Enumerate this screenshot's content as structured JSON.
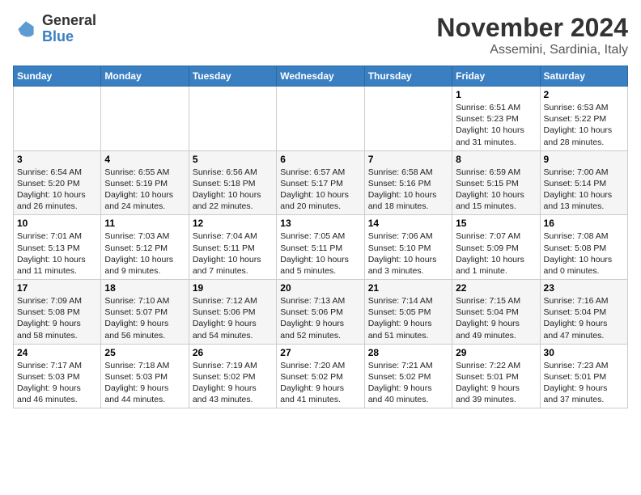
{
  "logo": {
    "general": "General",
    "blue": "Blue"
  },
  "title": "November 2024",
  "location": "Assemini, Sardinia, Italy",
  "weekdays": [
    "Sunday",
    "Monday",
    "Tuesday",
    "Wednesday",
    "Thursday",
    "Friday",
    "Saturday"
  ],
  "weeks": [
    [
      {
        "day": "",
        "info": ""
      },
      {
        "day": "",
        "info": ""
      },
      {
        "day": "",
        "info": ""
      },
      {
        "day": "",
        "info": ""
      },
      {
        "day": "",
        "info": ""
      },
      {
        "day": "1",
        "info": "Sunrise: 6:51 AM\nSunset: 5:23 PM\nDaylight: 10 hours\nand 31 minutes."
      },
      {
        "day": "2",
        "info": "Sunrise: 6:53 AM\nSunset: 5:22 PM\nDaylight: 10 hours\nand 28 minutes."
      }
    ],
    [
      {
        "day": "3",
        "info": "Sunrise: 6:54 AM\nSunset: 5:20 PM\nDaylight: 10 hours\nand 26 minutes."
      },
      {
        "day": "4",
        "info": "Sunrise: 6:55 AM\nSunset: 5:19 PM\nDaylight: 10 hours\nand 24 minutes."
      },
      {
        "day": "5",
        "info": "Sunrise: 6:56 AM\nSunset: 5:18 PM\nDaylight: 10 hours\nand 22 minutes."
      },
      {
        "day": "6",
        "info": "Sunrise: 6:57 AM\nSunset: 5:17 PM\nDaylight: 10 hours\nand 20 minutes."
      },
      {
        "day": "7",
        "info": "Sunrise: 6:58 AM\nSunset: 5:16 PM\nDaylight: 10 hours\nand 18 minutes."
      },
      {
        "day": "8",
        "info": "Sunrise: 6:59 AM\nSunset: 5:15 PM\nDaylight: 10 hours\nand 15 minutes."
      },
      {
        "day": "9",
        "info": "Sunrise: 7:00 AM\nSunset: 5:14 PM\nDaylight: 10 hours\nand 13 minutes."
      }
    ],
    [
      {
        "day": "10",
        "info": "Sunrise: 7:01 AM\nSunset: 5:13 PM\nDaylight: 10 hours\nand 11 minutes."
      },
      {
        "day": "11",
        "info": "Sunrise: 7:03 AM\nSunset: 5:12 PM\nDaylight: 10 hours\nand 9 minutes."
      },
      {
        "day": "12",
        "info": "Sunrise: 7:04 AM\nSunset: 5:11 PM\nDaylight: 10 hours\nand 7 minutes."
      },
      {
        "day": "13",
        "info": "Sunrise: 7:05 AM\nSunset: 5:11 PM\nDaylight: 10 hours\nand 5 minutes."
      },
      {
        "day": "14",
        "info": "Sunrise: 7:06 AM\nSunset: 5:10 PM\nDaylight: 10 hours\nand 3 minutes."
      },
      {
        "day": "15",
        "info": "Sunrise: 7:07 AM\nSunset: 5:09 PM\nDaylight: 10 hours\nand 1 minute."
      },
      {
        "day": "16",
        "info": "Sunrise: 7:08 AM\nSunset: 5:08 PM\nDaylight: 10 hours\nand 0 minutes."
      }
    ],
    [
      {
        "day": "17",
        "info": "Sunrise: 7:09 AM\nSunset: 5:08 PM\nDaylight: 9 hours\nand 58 minutes."
      },
      {
        "day": "18",
        "info": "Sunrise: 7:10 AM\nSunset: 5:07 PM\nDaylight: 9 hours\nand 56 minutes."
      },
      {
        "day": "19",
        "info": "Sunrise: 7:12 AM\nSunset: 5:06 PM\nDaylight: 9 hours\nand 54 minutes."
      },
      {
        "day": "20",
        "info": "Sunrise: 7:13 AM\nSunset: 5:06 PM\nDaylight: 9 hours\nand 52 minutes."
      },
      {
        "day": "21",
        "info": "Sunrise: 7:14 AM\nSunset: 5:05 PM\nDaylight: 9 hours\nand 51 minutes."
      },
      {
        "day": "22",
        "info": "Sunrise: 7:15 AM\nSunset: 5:04 PM\nDaylight: 9 hours\nand 49 minutes."
      },
      {
        "day": "23",
        "info": "Sunrise: 7:16 AM\nSunset: 5:04 PM\nDaylight: 9 hours\nand 47 minutes."
      }
    ],
    [
      {
        "day": "24",
        "info": "Sunrise: 7:17 AM\nSunset: 5:03 PM\nDaylight: 9 hours\nand 46 minutes."
      },
      {
        "day": "25",
        "info": "Sunrise: 7:18 AM\nSunset: 5:03 PM\nDaylight: 9 hours\nand 44 minutes."
      },
      {
        "day": "26",
        "info": "Sunrise: 7:19 AM\nSunset: 5:02 PM\nDaylight: 9 hours\nand 43 minutes."
      },
      {
        "day": "27",
        "info": "Sunrise: 7:20 AM\nSunset: 5:02 PM\nDaylight: 9 hours\nand 41 minutes."
      },
      {
        "day": "28",
        "info": "Sunrise: 7:21 AM\nSunset: 5:02 PM\nDaylight: 9 hours\nand 40 minutes."
      },
      {
        "day": "29",
        "info": "Sunrise: 7:22 AM\nSunset: 5:01 PM\nDaylight: 9 hours\nand 39 minutes."
      },
      {
        "day": "30",
        "info": "Sunrise: 7:23 AM\nSunset: 5:01 PM\nDaylight: 9 hours\nand 37 minutes."
      }
    ]
  ]
}
